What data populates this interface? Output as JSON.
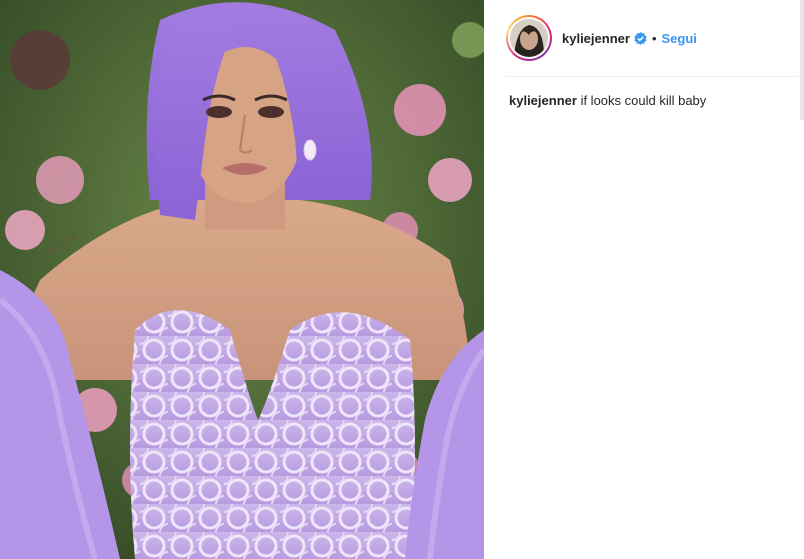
{
  "post": {
    "image_alt": "Woman with lavender hair in a lilac beaded corset gown with feather sleeves",
    "watermark": "KYLIE COSM"
  },
  "header": {
    "username": "kyliejenner",
    "verified_icon": "verified-badge-icon",
    "separator": "•",
    "follow_label": "Segui"
  },
  "caption": {
    "username": "kyliejenner",
    "text": "if looks could kill baby"
  },
  "colors": {
    "link_blue": "#3897f0",
    "verified_blue": "#3897f0",
    "text": "#262626",
    "divider": "#efefef"
  }
}
